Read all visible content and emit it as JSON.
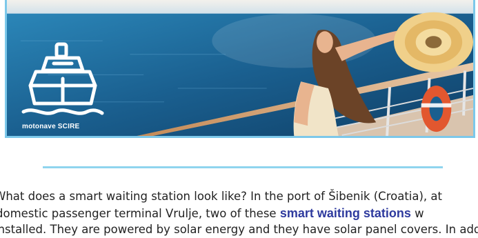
{
  "banner": {
    "logo_label": "motonave SCIRE",
    "colors": {
      "border": "#7cc8ea",
      "sea": "#1a5f8f",
      "sky": "#dfe8ee"
    }
  },
  "article": {
    "line1": "What does a smart waiting station look like? In the port of Šibenik (Croatia), at",
    "line2_before": "domestic passenger terminal Vrulje, two of these",
    "line2_highlight": "smart waiting stations",
    "line2_after": "w",
    "line3": "installed. They are powered by solar energy and they have solar panel covers. In addi",
    "highlight_color": "#2e3a9e"
  }
}
